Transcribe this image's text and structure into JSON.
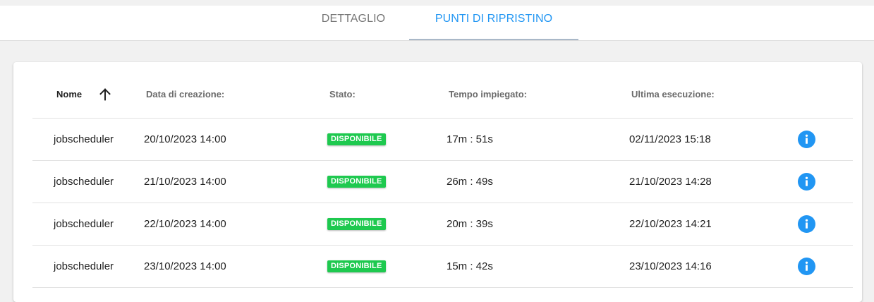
{
  "tabs": [
    {
      "label": "DETTAGLIO",
      "active": false
    },
    {
      "label": "PUNTI DI RIPRISTINO",
      "active": true
    }
  ],
  "colors": {
    "accent": "#2196f3",
    "status_available": "#1ec94f",
    "info_icon": "#2196f3"
  },
  "table": {
    "headers": {
      "nome": "Nome",
      "data_creazione": "Data di creazione:",
      "stato": "Stato:",
      "tempo": "Tempo impiegato:",
      "ultima": "Ultima esecuzione:"
    },
    "sort": {
      "column": "Nome",
      "direction": "ascending",
      "icon": "arrow-up-icon"
    },
    "rows": [
      {
        "nome": "jobscheduler",
        "data_creazione": "20/10/2023 14:00",
        "stato": "DISPONIBILE",
        "tempo": "17m : 51s",
        "ultima": "02/11/2023 15:18",
        "icon": "info-icon"
      },
      {
        "nome": "jobscheduler",
        "data_creazione": "21/10/2023 14:00",
        "stato": "DISPONIBILE",
        "tempo": "26m : 49s",
        "ultima": "21/10/2023 14:28",
        "icon": "info-icon"
      },
      {
        "nome": "jobscheduler",
        "data_creazione": "22/10/2023 14:00",
        "stato": "DISPONIBILE",
        "tempo": "20m : 39s",
        "ultima": "22/10/2023 14:21",
        "icon": "info-icon"
      },
      {
        "nome": "jobscheduler",
        "data_creazione": "23/10/2023 14:00",
        "stato": "DISPONIBILE",
        "tempo": "15m : 42s",
        "ultima": "23/10/2023 14:16",
        "icon": "info-icon"
      }
    ]
  }
}
